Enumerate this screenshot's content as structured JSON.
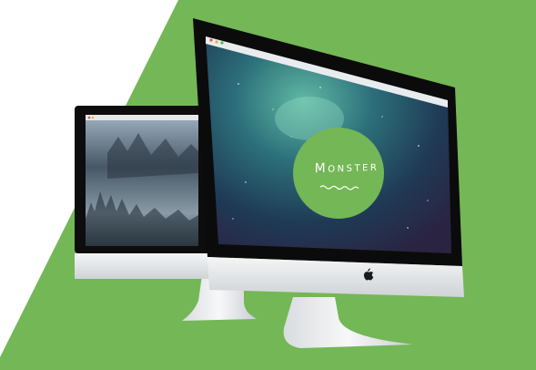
{
  "hero": {
    "logo_text": "Monster"
  },
  "colors": {
    "accent_green": "#74b756",
    "page_background": "#ffffff",
    "screen_dark": "#1a2c3a",
    "bezel": "#0c0c0c",
    "aluminum": "#e6e8ea"
  },
  "icons": [
    "apple-logo-icon",
    "wave-divider-icon"
  ]
}
